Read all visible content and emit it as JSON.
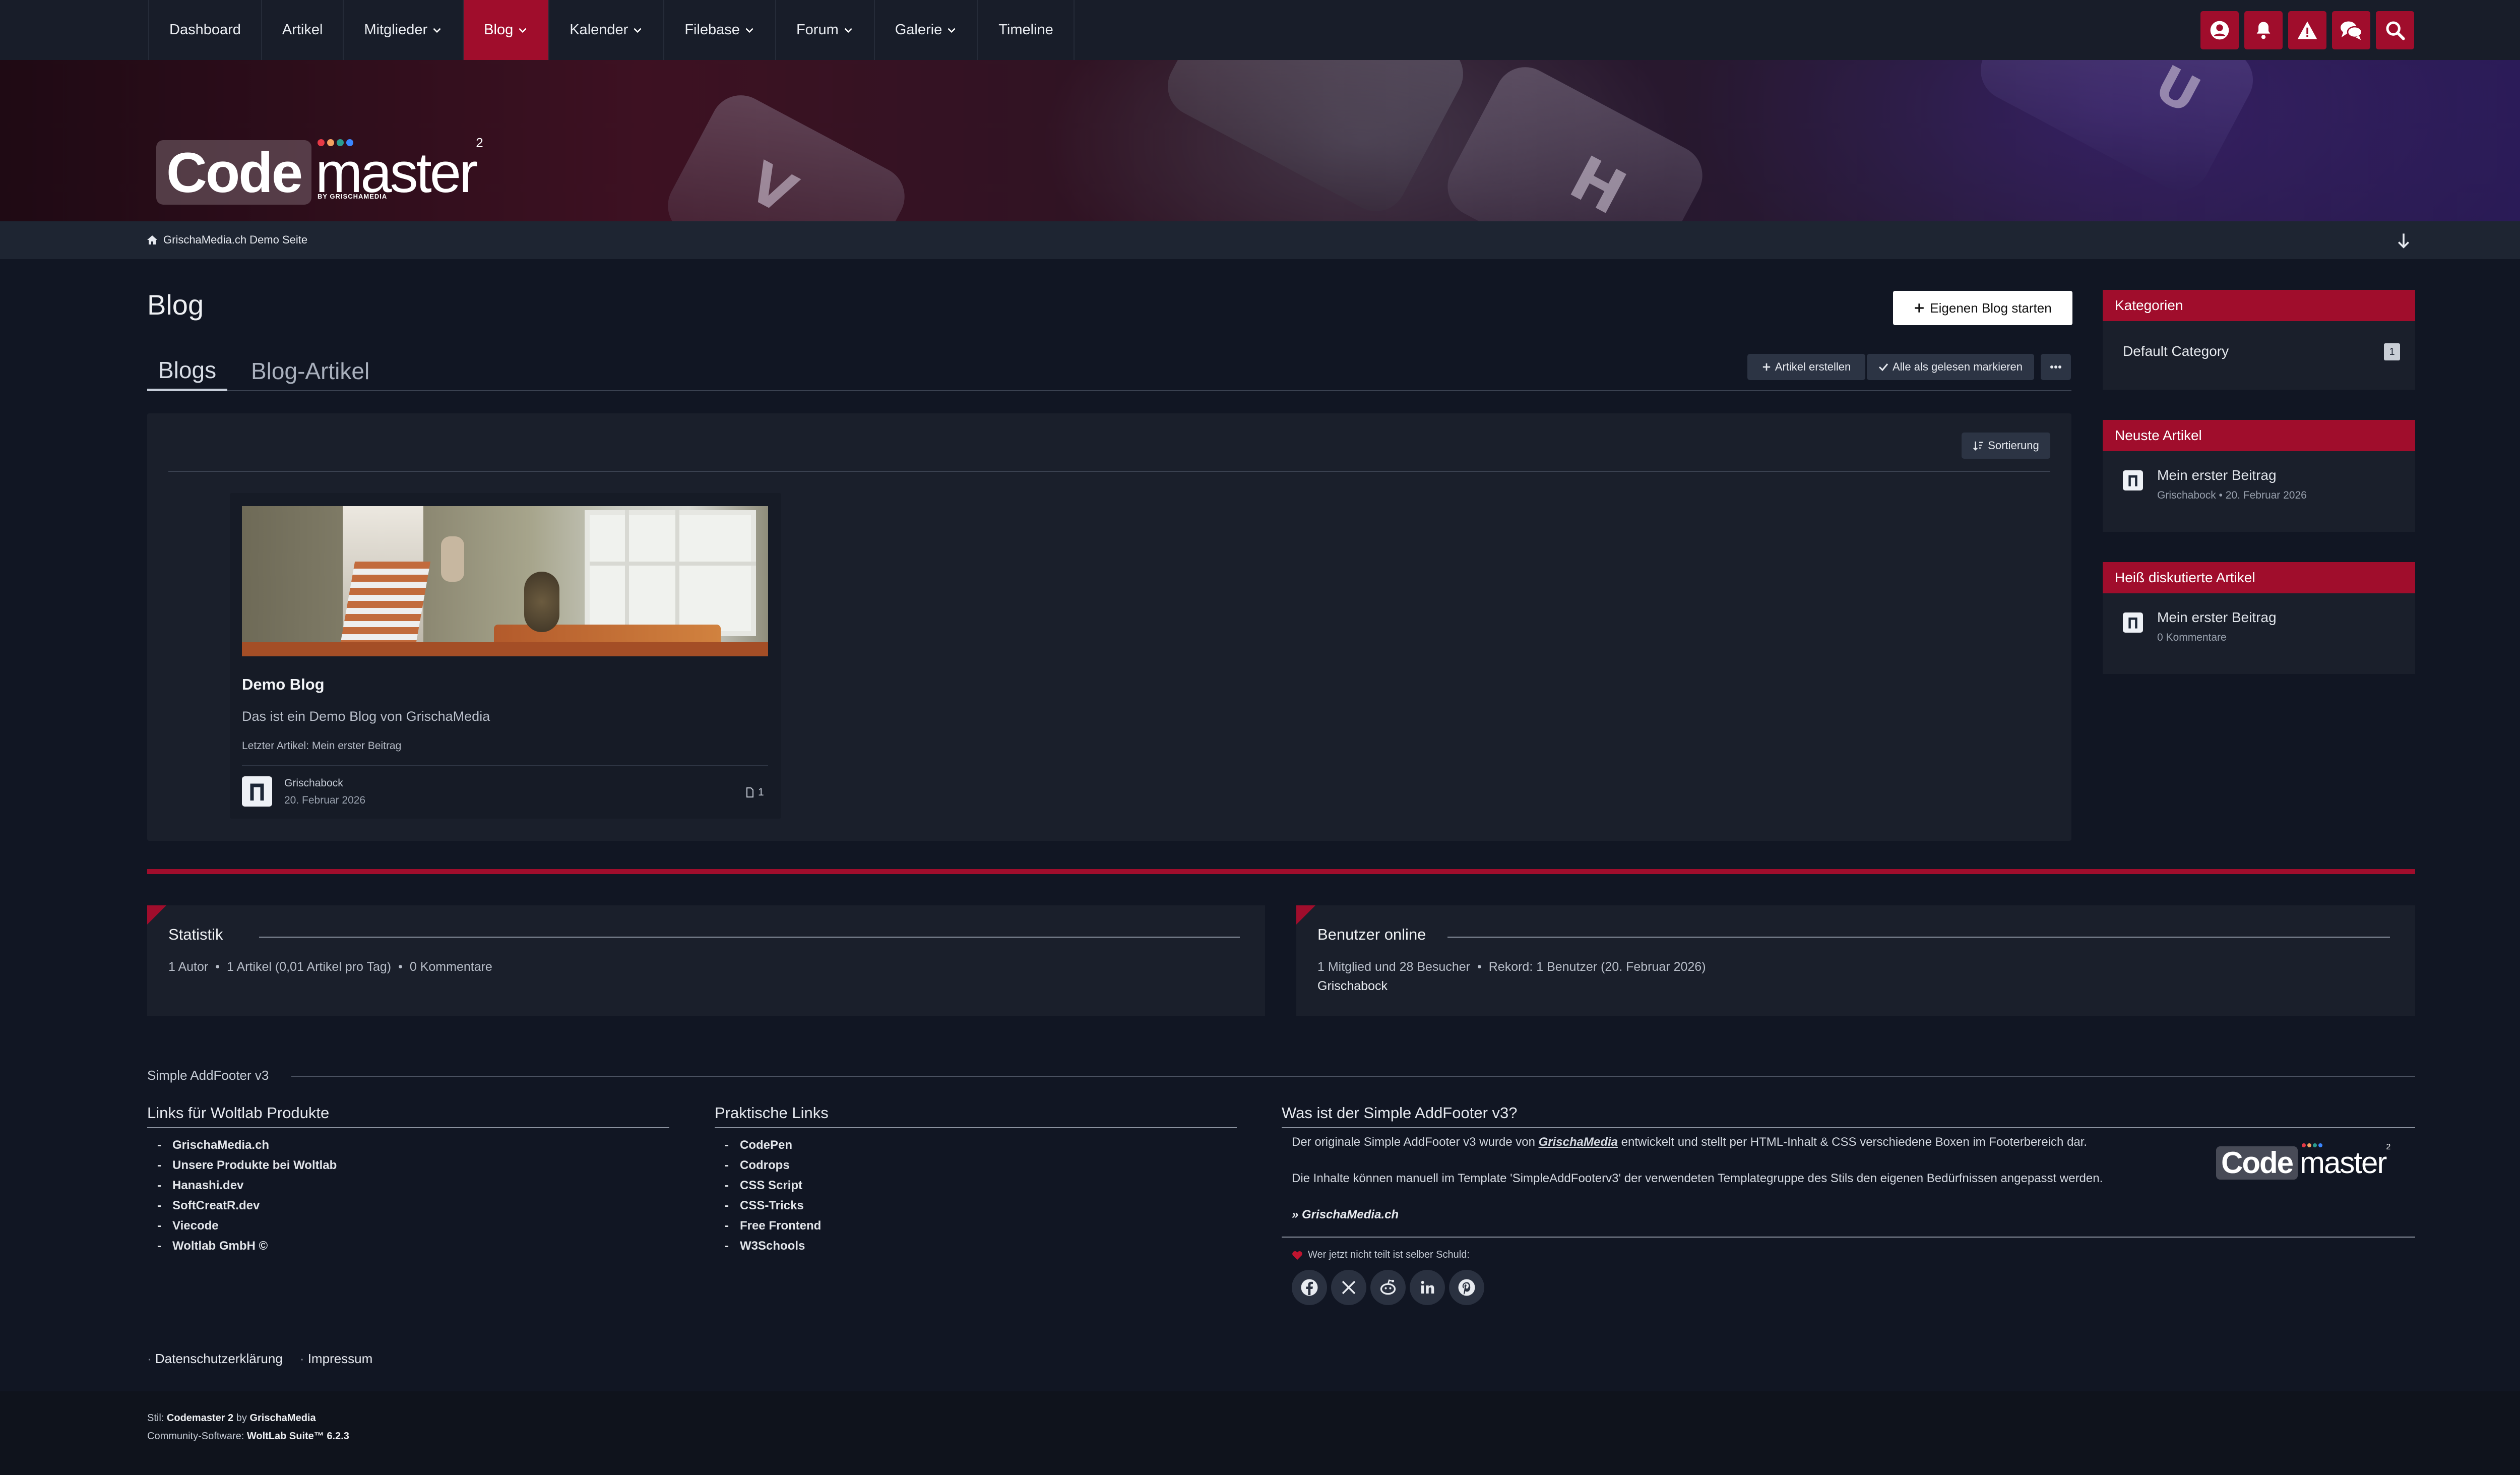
{
  "nav": {
    "items": [
      {
        "label": "Dashboard",
        "dropdown": false
      },
      {
        "label": "Artikel",
        "dropdown": false
      },
      {
        "label": "Mitglieder",
        "dropdown": true
      },
      {
        "label": "Blog",
        "dropdown": true,
        "active": true
      },
      {
        "label": "Kalender",
        "dropdown": true
      },
      {
        "label": "Filebase",
        "dropdown": true
      },
      {
        "label": "Forum",
        "dropdown": true
      },
      {
        "label": "Galerie",
        "dropdown": true
      },
      {
        "label": "Timeline",
        "dropdown": false
      }
    ],
    "user_icons": [
      "user-circle-icon",
      "bell-icon",
      "warning-icon",
      "conversations-icon",
      "search-icon"
    ]
  },
  "logo": {
    "code": "Code",
    "master": "master",
    "sup": "2",
    "by": "BY GRISCHAMEDIA"
  },
  "breadcrumb": {
    "home": "GrischaMedia.ch Demo Seite"
  },
  "page": {
    "title": "Blog",
    "start_button": "Eigenen Blog starten",
    "tabs": [
      "Blogs",
      "Blog-Artikel"
    ],
    "actions": {
      "create": "Artikel erstellen",
      "mark_read": "Alle als gelesen markieren"
    },
    "sort": "Sortierung"
  },
  "blog_card": {
    "title": "Demo Blog",
    "description": "Das ist ein Demo Blog von GrischaMedia",
    "last_article": "Letzter Artikel: Mein erster Beitrag",
    "author": "Grischabock",
    "date": "20. Februar 2026",
    "count": "1"
  },
  "sidebar": {
    "categories": {
      "title": "Kategorien",
      "items": [
        {
          "label": "Default Category",
          "count": "1"
        }
      ]
    },
    "newest": {
      "title": "Neuste Artikel",
      "items": [
        {
          "title": "Mein erster Beitrag",
          "meta": "Grischabock • 20. Februar 2026"
        }
      ]
    },
    "hot": {
      "title": "Heiß diskutierte Artikel",
      "items": [
        {
          "title": "Mein erster Beitrag",
          "meta": "0 Kommentare"
        }
      ]
    }
  },
  "stats": {
    "title": "Statistik",
    "items": [
      "1 Autor",
      "1 Artikel (0,01 Artikel pro Tag)",
      "0 Kommentare"
    ]
  },
  "online": {
    "title": "Benutzer online",
    "items": [
      "1 Mitglied und 28 Besucher",
      "Rekord: 1 Benutzer (20. Februar 2026)"
    ],
    "users": "Grischabock"
  },
  "footer": {
    "title": "Simple AddFooter v3",
    "col1": {
      "title": "Links für Woltlab Produkte",
      "links": [
        "GrischaMedia.ch",
        "Unsere Produkte bei Woltlab",
        "Hanashi.dev",
        "SoftCreatR.dev",
        "Viecode",
        "Woltlab GmbH ©"
      ]
    },
    "col2": {
      "title": "Praktische Links",
      "links": [
        "CodePen",
        "Codrops",
        "CSS Script",
        "CSS-Tricks",
        "Free Frontend",
        "W3Schools"
      ]
    },
    "col3": {
      "title": "Was ist der Simple AddFooter v3?",
      "text1_a": "Der originale Simple AddFooter v3 wurde von ",
      "text1_b": "GrischaMedia",
      "text1_c": " entwickelt und stellt per HTML-Inhalt & CSS verschiedene Boxen im Footerbereich dar.",
      "text2": "Die Inhalte können manuell im Template 'SimpleAddFooterv3' der verwendeten Templategruppe des Stils den eigenen Bedürfnissen angepasst werden.",
      "link": "» GrischaMedia.ch"
    },
    "share_text": "Wer jetzt nicht teilt ist selber Schuld:",
    "social": [
      "facebook-icon",
      "x-icon",
      "reddit-icon",
      "linkedin-icon",
      "pinterest-icon"
    ]
  },
  "legal": {
    "privacy": "Datenschutzerklärung",
    "imprint": "Impressum"
  },
  "copyright": {
    "style_prefix": "Stil: ",
    "style_name": "Codemaster 2",
    "style_by": " by ",
    "style_author": "GrischaMedia",
    "software_prefix": "Community-Software: ",
    "software": "WoltLab Suite™ 6.2.3"
  }
}
